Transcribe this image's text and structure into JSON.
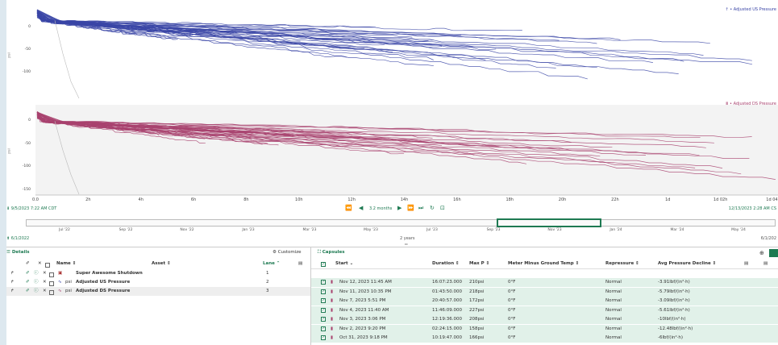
{
  "chart_data": [
    {
      "type": "line",
      "legend": "↑ • Adjusted US Pressure",
      "ylabel": "psi",
      "yticks": [
        "0",
        "-50",
        "-100"
      ],
      "color": "#3a45a6",
      "ylim": [
        -140,
        25
      ]
    },
    {
      "type": "line",
      "legend": "ⅲ • Adjusted DS Pressure",
      "ylabel": "psi",
      "yticks": [
        "0",
        "-50",
        "-100",
        "-150"
      ],
      "color": "#a8426e",
      "ylim": [
        -150,
        25
      ]
    }
  ],
  "xaxis": {
    "ticks": [
      "0.0",
      "2h",
      "4h",
      "6h",
      "8h",
      "10h",
      "12h",
      "14h",
      "16h",
      "18h",
      "20h",
      "22h",
      "1d",
      "1d 02h",
      "1d 04h"
    ]
  },
  "nav": {
    "start": "9/5/2023 7:22 AM CDT",
    "end": "12/13/2023 2:28 AM CS",
    "duration": "3.2 months"
  },
  "timeline": {
    "ticks": [
      "Jul '22",
      "Sep '22",
      "Nov '22",
      "Jan '23",
      "Mar '23",
      "May '23",
      "Jul '23",
      "Sep '23",
      "Nov '23",
      "Jan '24",
      "Mar '24",
      "May '24"
    ],
    "start": "6/1/2022",
    "end": "6/1/202",
    "span": "2 years"
  },
  "details": {
    "title": "Details",
    "customize": "Customize",
    "cols": {
      "name": "Name",
      "asset": "Asset",
      "lane": "Lane"
    },
    "rows": [
      {
        "name": "Super Awesome Shutdown",
        "unit": "",
        "lane": "1"
      },
      {
        "name": "Adjusted US Pressure",
        "unit": "psi",
        "lane": "2"
      },
      {
        "name": "Adjusted DS Pressure",
        "unit": "psi",
        "lane": "3"
      }
    ]
  },
  "capsules": {
    "title": "Capsules",
    "cols": {
      "start": "Start",
      "duration": "Duration",
      "maxp": "Max P",
      "meter": "Meter Minus Ground Temp",
      "repress": "Repressure",
      "avg": "Avg Pressure Decline"
    },
    "rows": [
      {
        "start": "Nov 12, 2023 11:45 AM",
        "duration": "16:07:23.000",
        "maxp": "210psi",
        "meter": "0°F",
        "repress": "Normal",
        "avg": "-3.91lbf/(in²·h)"
      },
      {
        "start": "Nov 11, 2023 10:35 PM",
        "duration": "01:43:50.000",
        "maxp": "218psi",
        "meter": "0°F",
        "repress": "Normal",
        "avg": "-5.79lbf/(in²·h)"
      },
      {
        "start": "Nov 7, 2023 5:51 PM",
        "duration": "20:40:57.000",
        "maxp": "172psi",
        "meter": "0°F",
        "repress": "Normal",
        "avg": "-3.09lbf/(in²·h)"
      },
      {
        "start": "Nov 4, 2023 11:40 AM",
        "duration": "11:46:09.000",
        "maxp": "227psi",
        "meter": "0°F",
        "repress": "Normal",
        "avg": "-5.61lbf/(in²·h)"
      },
      {
        "start": "Nov 3, 2023 3:06 PM",
        "duration": "12:19:36.000",
        "maxp": "208psi",
        "meter": "0°F",
        "repress": "Normal",
        "avg": "-10lbf/(in²·h)"
      },
      {
        "start": "Nov 2, 2023 9:20 PM",
        "duration": "02:24:15.000",
        "maxp": "158psi",
        "meter": "0°F",
        "repress": "Normal",
        "avg": "-12.48lbf/(in²·h)"
      },
      {
        "start": "Oct 31, 2023 9:18 PM",
        "duration": "10:19:47.000",
        "maxp": "166psi",
        "meter": "0°F",
        "repress": "Normal",
        "avg": "-6lbf/(in²·h)"
      }
    ]
  }
}
